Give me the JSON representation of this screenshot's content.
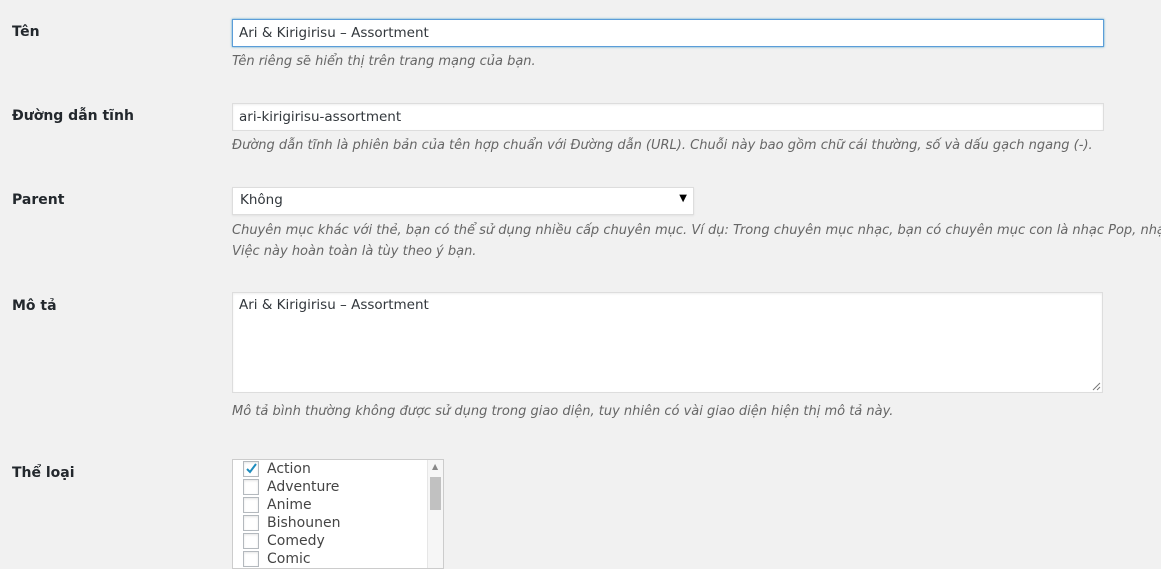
{
  "name": {
    "label": "Tên",
    "value": "Ari & Kirigirisu – Assortment",
    "description": "Tên riêng sẽ hiển thị trên trang mạng của bạn."
  },
  "slug": {
    "label": "Đường dẫn tĩnh",
    "value": "ari-kirigirisu-assortment",
    "description": "Đường dẫn tĩnh là phiên bản của tên hợp chuẩn với Đường dẫn (URL). Chuỗi này bao gồm chữ cái thường, số và dấu gạch ngang (-)."
  },
  "parent": {
    "label": "Parent",
    "selected": "Không",
    "description_line1": "Chuyên mục khác với thẻ, bạn có thể sử dụng nhiều cấp chuyên mục. Ví dụ: Trong chuyên mục nhạc, bạn có chuyên mục con là nhạc Pop, nhạc Jazz.",
    "description_line2": "Việc này hoàn toàn là tùy theo ý bạn."
  },
  "description_field": {
    "label": "Mô tả",
    "value": "Ari & Kirigirisu – Assortment",
    "description": "Mô tả bình thường không được sử dụng trong giao diện, tuy nhiên có vài giao diện hiện thị mô tả này."
  },
  "genre": {
    "label": "Thể loại",
    "items": [
      {
        "label": "Action",
        "checked": true
      },
      {
        "label": "Adventure",
        "checked": false
      },
      {
        "label": "Anime",
        "checked": false
      },
      {
        "label": "Bishounen",
        "checked": false
      },
      {
        "label": "Comedy",
        "checked": false
      },
      {
        "label": "Comic",
        "checked": false
      }
    ]
  },
  "colors": {
    "focus_border": "#5b9dd9",
    "check_mark": "#1e8cbe"
  }
}
